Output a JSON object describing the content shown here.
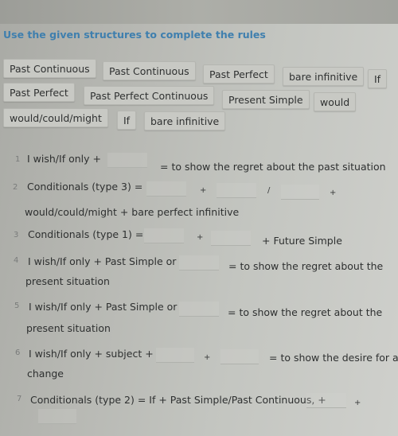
{
  "title": "Use the given structures to complete the rules",
  "word_bank": [
    "Past Continuous",
    "Past Continuous",
    "Past Perfect",
    "bare infinitive",
    "If",
    "Past Perfect",
    "Past Perfect Continuous",
    "Present Simple",
    "would",
    "would/could/might",
    "If",
    "bare infinitive"
  ],
  "rules": [
    {
      "number": "1",
      "parts": [
        "I wish/If only +",
        "= to show the regret about the past situation"
      ]
    },
    {
      "number": "2",
      "parts": [
        "Conditionals (type 3) =",
        "+",
        "/",
        "+",
        "would/could/might + bare perfect infinitive"
      ]
    },
    {
      "number": "3",
      "parts": [
        "Conditionals (type 1) =",
        "+",
        "+ Future Simple"
      ]
    },
    {
      "number": "4",
      "parts": [
        "I wish/If only + Past Simple or",
        "= to show the regret about the",
        "present situation"
      ]
    },
    {
      "number": "5",
      "parts": [
        "I wish/If only + Past Simple or",
        "= to show the regret about the",
        "present situation"
      ]
    },
    {
      "number": "6",
      "parts": [
        "I wish/If only + subject +",
        "+",
        "= to show the desire for a",
        "change"
      ]
    },
    {
      "number": "7",
      "parts": [
        "Conditionals (type 2) = If + Past Simple/Past Continuous, +",
        "+"
      ]
    }
  ],
  "colors": {
    "title": "#3f7fae",
    "background": "#c3c5c0",
    "tile": "#c8c9c4"
  }
}
